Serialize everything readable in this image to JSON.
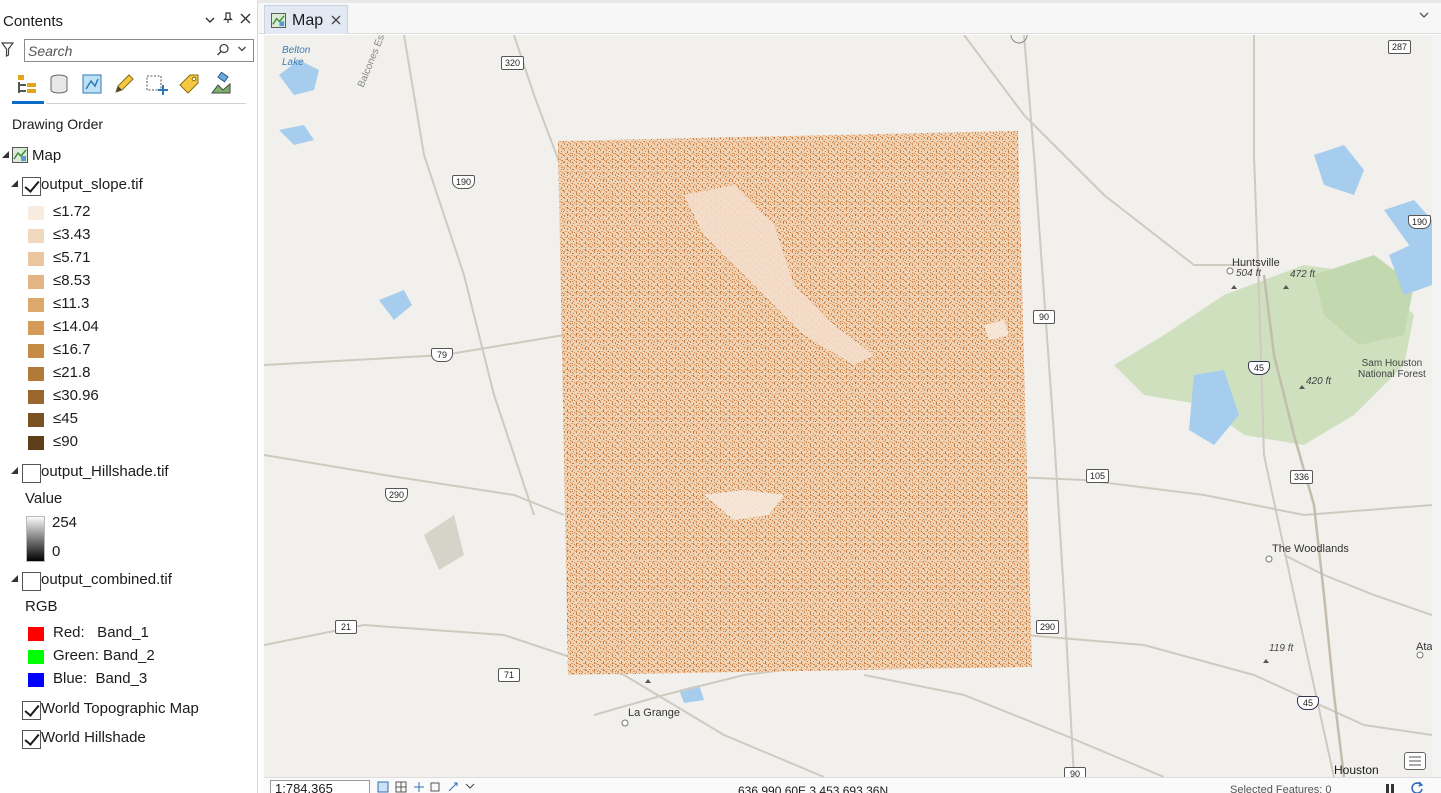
{
  "contents": {
    "title": "Contents",
    "search": {
      "placeholder": "Search"
    },
    "tools": [
      "list-by-drawing-order-icon",
      "list-by-data-source-icon",
      "list-by-selection-icon",
      "list-by-editing-icon",
      "list-by-snapping-icon",
      "list-by-labeling-icon",
      "list-by-perspective-imagery-icon"
    ],
    "drawing_order_title": "Drawing Order",
    "map_label": "Map",
    "layers": {
      "slope": {
        "name": "output_slope.tif",
        "checked": true,
        "classes": [
          {
            "label": "≤1.72",
            "color": "#f8ece1"
          },
          {
            "label": "≤3.43",
            "color": "#f1d9c0"
          },
          {
            "label": "≤5.71",
            "color": "#eac6a0"
          },
          {
            "label": "≤8.53",
            "color": "#e3b585"
          },
          {
            "label": "≤11.3",
            "color": "#dca86c"
          },
          {
            "label": "≤14.04",
            "color": "#d49c58"
          },
          {
            "label": "≤16.7",
            "color": "#c78c44"
          },
          {
            "label": "≤21.8",
            "color": "#b27a38"
          },
          {
            "label": "≤30.96",
            "color": "#98662e"
          },
          {
            "label": "≤45",
            "color": "#7b5224"
          },
          {
            "label": "≤90",
            "color": "#5f3f1a"
          }
        ]
      },
      "hillshade": {
        "name": "output_Hillshade.tif",
        "checked": false,
        "value_title": "Value",
        "high": "254",
        "low": "0"
      },
      "combined": {
        "name": "output_combined.tif",
        "checked": false,
        "rgb_title": "RGB",
        "bands": [
          {
            "label": "Red:   Band_1",
            "color": "#ff0000"
          },
          {
            "label": "Green: Band_2",
            "color": "#00ff00"
          },
          {
            "label": "Blue:  Band_3",
            "color": "#0000ff"
          }
        ]
      },
      "topo": {
        "name": "World Topographic Map",
        "checked": true
      },
      "world_hillshade": {
        "name": "World Hillshade",
        "checked": true
      }
    }
  },
  "map_view": {
    "tab_label": "Map",
    "place_labels": {
      "belton_lake": "Belton\nLake",
      "balcones": "Balcones Escarp",
      "huntsville": "Huntsville",
      "elev_504": "504 ft",
      "elev_472": "472 ft",
      "sam_houston": "Sam Houston\nNational Forest",
      "elev_420": "420 ft",
      "woodlands": "The Woodlands",
      "elev_119": "119 ft",
      "la_grange": "La Grange",
      "houston": "Houston",
      "ata": "Ata"
    },
    "road_shields": {
      "r320": "320",
      "r190a": "190",
      "r190b": "190",
      "r79": "79",
      "r90": "90",
      "r45a": "45",
      "r105": "105",
      "r336": "336",
      "r290a": "290",
      "r290b": "290",
      "r21": "21",
      "r71": "71",
      "r45b": "45",
      "r287": "287",
      "r90b": "90"
    }
  },
  "status_bar": {
    "scale": "1:784,365",
    "coordinates": "636,990.60E 3,453,693.36N",
    "selected_features": "Selected Features: 0"
  },
  "colors": {
    "accent": "#0a6cc9",
    "raster_base": "#f0cfae",
    "raster_dark": "#cf8a4e"
  }
}
